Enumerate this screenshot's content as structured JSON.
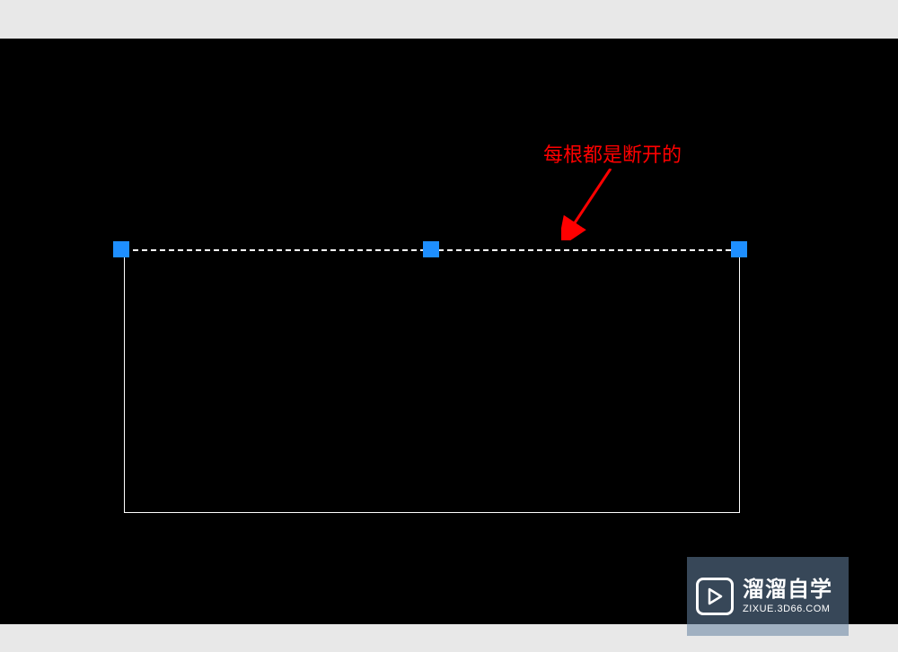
{
  "annotation": {
    "text": "每根都是断开的"
  },
  "watermark": {
    "title": "溜溜自学",
    "url": "ZIXUE.3D66.COM"
  },
  "diagram": {
    "selected_line": "top",
    "grips_count": 3,
    "arrow_color": "#ff0000",
    "grip_color": "#1e8fff"
  }
}
